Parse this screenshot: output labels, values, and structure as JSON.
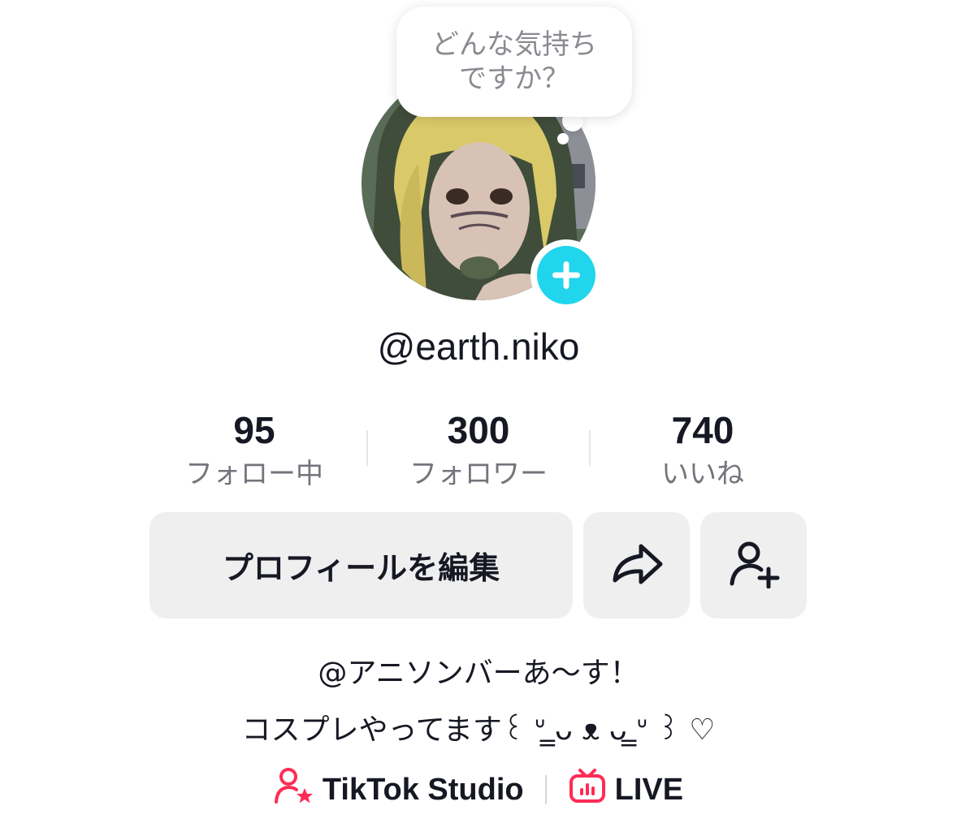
{
  "bubble": {
    "line1": "どんな気持ち",
    "line2": "ですか？"
  },
  "profile": {
    "username": "@earth.niko"
  },
  "stats": [
    {
      "value": "95",
      "label": "フォロー中"
    },
    {
      "value": "300",
      "label": "フォロワー"
    },
    {
      "value": "740",
      "label": "いいね"
    }
  ],
  "actions": {
    "edit_label": "プロフィールを編集",
    "share_icon": "share-arrow-icon",
    "add_friend_icon": "person-plus-icon"
  },
  "bio": {
    "line1": "@アニソンバーあ〜す！",
    "line2": "コスプレやってます꒰ ᐡ ̳ᴗ ᴥ ᴗ ̳ᐡ ꒱ ♡"
  },
  "links": {
    "studio_label": "TikTok Studio",
    "live_label": "LIVE"
  },
  "colors": {
    "accent_add": "#20d5ec",
    "link_icon": "#fe2c55",
    "text_primary": "#161823",
    "text_secondary": "#73757c",
    "button_bg": "#efefef"
  }
}
